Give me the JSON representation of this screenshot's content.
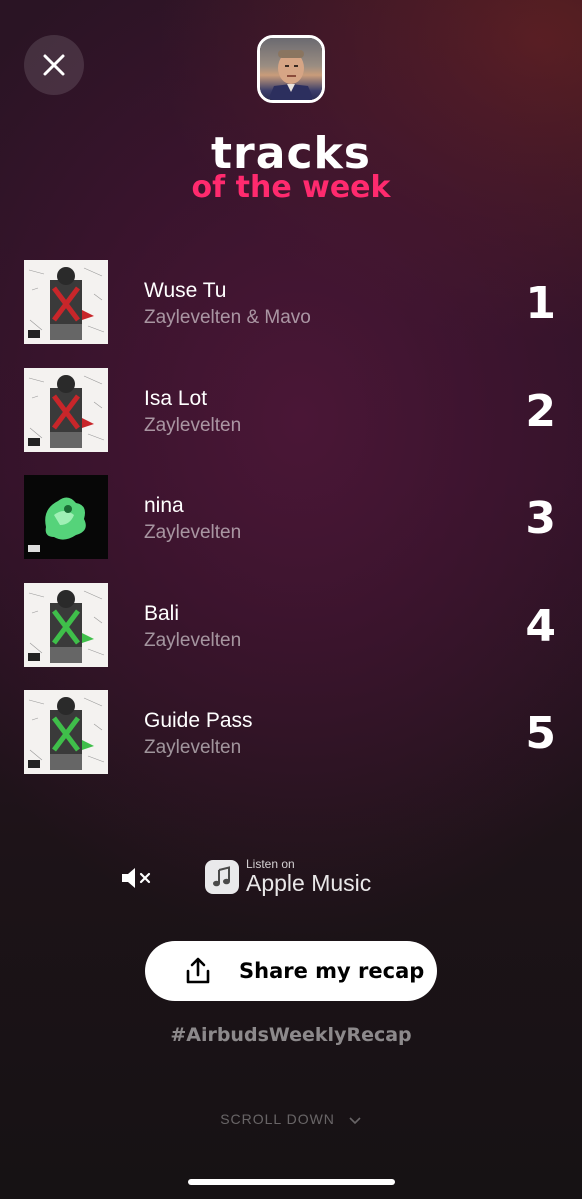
{
  "header": {
    "close_icon": "close-icon",
    "title": "tracks",
    "subtitle": "of the week"
  },
  "colors": {
    "accent": "#ff2a6e",
    "share_button_bg": "#ffffff"
  },
  "tracks": [
    {
      "rank": "1",
      "title": "Wuse Tu",
      "artist": "Zaylevelten & Mavo",
      "cover": "white"
    },
    {
      "rank": "2",
      "title": "Isa Lot",
      "artist": "Zaylevelten",
      "cover": "white"
    },
    {
      "rank": "3",
      "title": "nina",
      "artist": "Zaylevelten",
      "cover": "black"
    },
    {
      "rank": "4",
      "title": "Bali",
      "artist": "Zaylevelten",
      "cover": "white"
    },
    {
      "rank": "5",
      "title": "Guide Pass",
      "artist": "Zaylevelten",
      "cover": "white"
    }
  ],
  "controls": {
    "mute_icon": "speaker-muted-icon",
    "listen_on": "Listen on",
    "service": "Apple Music"
  },
  "share": {
    "label": "Share my recap",
    "icon": "share-icon"
  },
  "hashtag": "#AirbudsWeeklyRecap",
  "scroll_hint": "SCROLL DOWN"
}
